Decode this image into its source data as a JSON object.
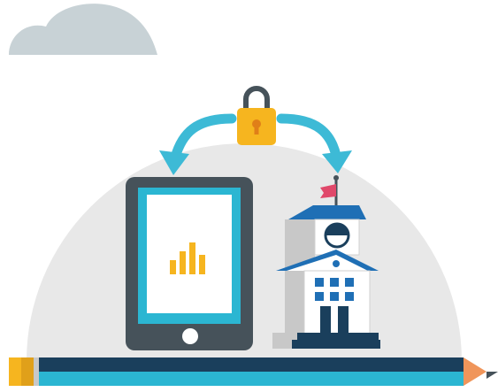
{
  "illustration": {
    "colors": {
      "cloud": "#c8d2d6",
      "dome": "#e8e8e8",
      "tablet_frame": "#46525a",
      "tablet_screen_border": "#2bb6d2",
      "tablet_screen": "#ffffff",
      "chart_bars": "#f6b51f",
      "arrow": "#3dbad6",
      "lock_body": "#f6b51f",
      "lock_shackle": "#46525a",
      "school_roof": "#1f6fb5",
      "school_wall": "#ffffff",
      "school_shadow": "#c8c8c8",
      "flag": "#e0486a",
      "pencil_navy": "#1a3f5c",
      "pencil_teal": "#2bb6d2",
      "pencil_eraser": "#f6b51f",
      "pencil_tip": "#f0955a"
    },
    "icons": [
      "cloud-icon",
      "padlock-icon",
      "curved-arrow-left-icon",
      "curved-arrow-right-icon",
      "tablet-icon",
      "bar-chart-icon",
      "school-building-icon",
      "clock-icon",
      "flag-icon",
      "pencil-icon"
    ]
  }
}
